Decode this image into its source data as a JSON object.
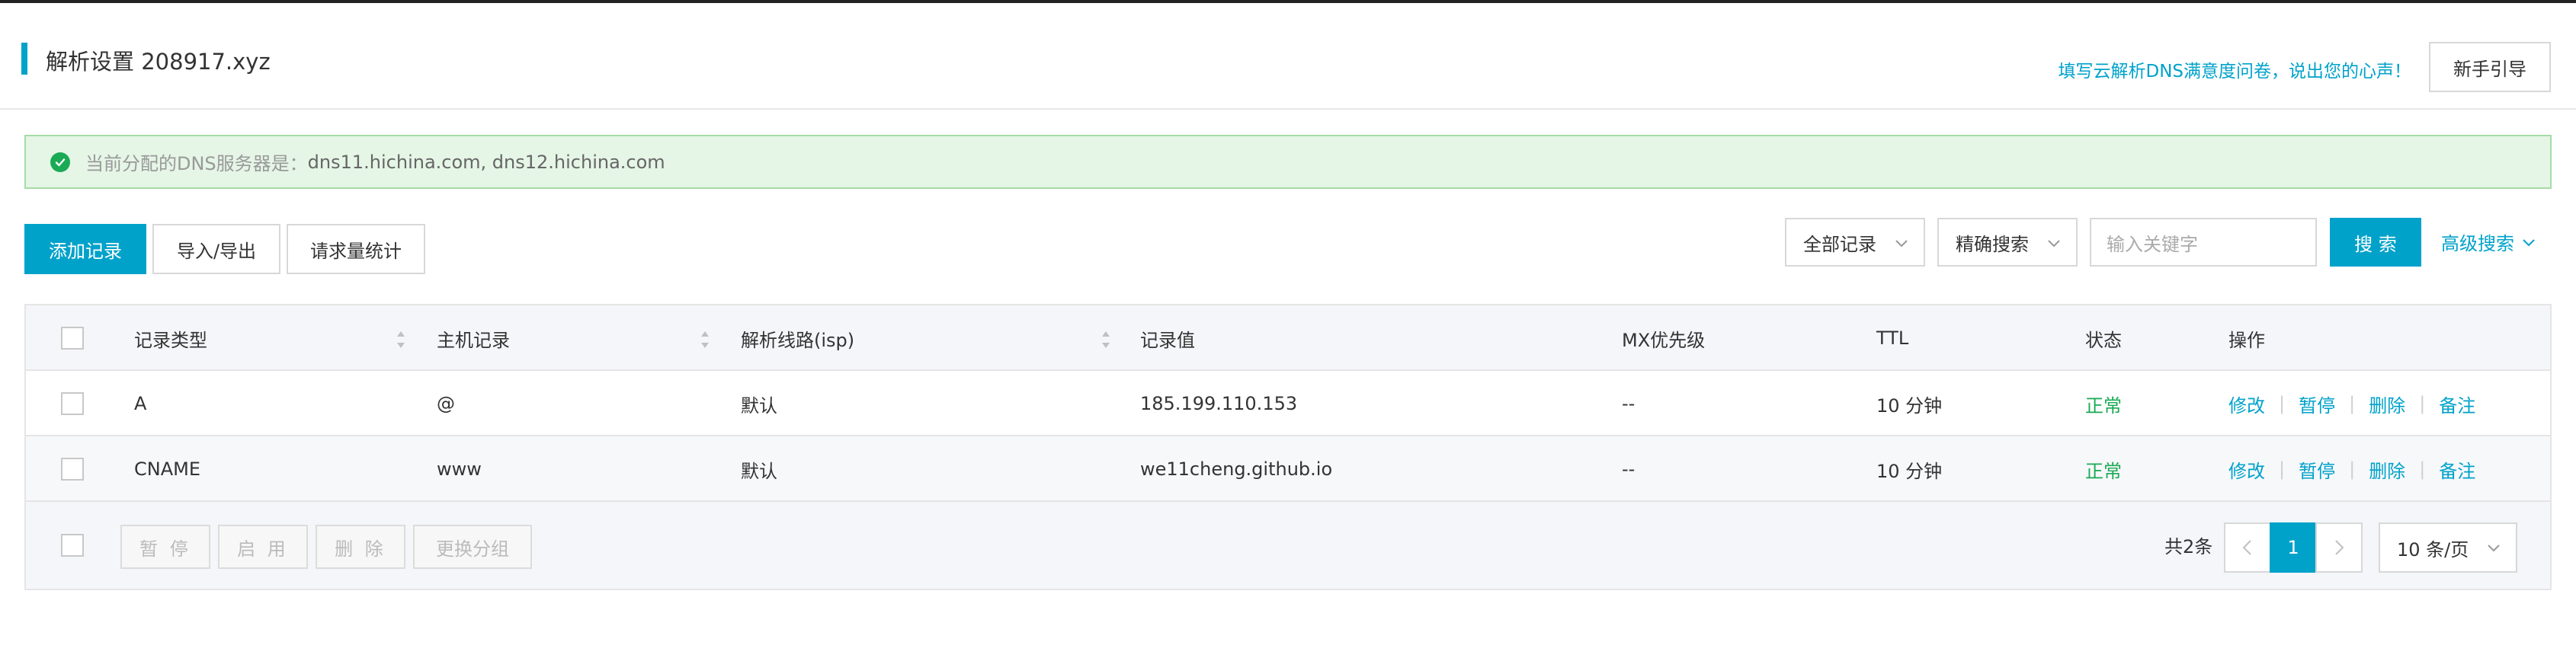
{
  "header": {
    "title": "解析设置 208917.xyz",
    "survey_link": "填写云解析DNS满意度问卷，说出您的心声！",
    "guide_button": "新手引导"
  },
  "notice": {
    "label": "当前分配的DNS服务器是：",
    "value": "dns11.hichina.com, dns12.hichina.com"
  },
  "toolbar": {
    "add_record": "添加记录",
    "import_export": "导入/导出",
    "request_stats": "请求量统计",
    "filter_select": "全部记录",
    "search_mode_select": "精确搜索",
    "keyword_placeholder": "输入关键字",
    "search_button": "搜 索",
    "advanced_search": "高级搜索"
  },
  "table": {
    "columns": [
      "记录类型",
      "主机记录",
      "解析线路(isp)",
      "记录值",
      "MX优先级",
      "TTL",
      "状态",
      "操作"
    ],
    "rows": [
      {
        "type": "A",
        "host": "@",
        "line": "默认",
        "value": "185.199.110.153",
        "mx": "--",
        "ttl": "10 分钟",
        "status": "正常"
      },
      {
        "type": "CNAME",
        "host": "www",
        "line": "默认",
        "value": "we11cheng.github.io",
        "mx": "--",
        "ttl": "10 分钟",
        "status": "正常"
      }
    ],
    "actions": [
      "修改",
      "暂停",
      "删除",
      "备注"
    ]
  },
  "footer": {
    "bulk_actions": [
      "暂 停",
      "启 用",
      "删 除",
      "更换分组"
    ],
    "total": "共2条",
    "current_page": "1",
    "page_size": "10 条/页"
  },
  "colors": {
    "accent": "#00a2ca",
    "success": "#1aaa55",
    "notice_bg": "#e5f5e6"
  }
}
